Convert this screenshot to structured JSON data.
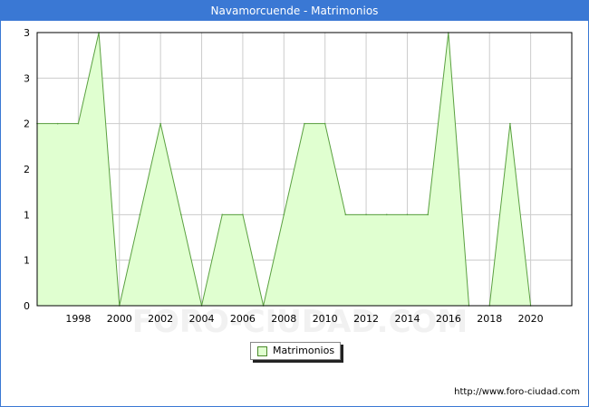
{
  "title": "Navamorcuende - Matrimonios",
  "footer_url": "http://www.foro-ciudad.com",
  "watermark": "FORO-CIUDAD.COM",
  "colors": {
    "title_bg": "#3a78d4",
    "area_fill": "#e0ffd0",
    "area_stroke": "#5aa040",
    "grid": "#cccccc"
  },
  "chart_data": {
    "type": "area",
    "title": "Navamorcuende - Matrimonios",
    "xlabel": "",
    "ylabel": "",
    "x": [
      1996,
      1997,
      1998,
      1999,
      2000,
      2001,
      2002,
      2003,
      2004,
      2005,
      2006,
      2007,
      2008,
      2009,
      2010,
      2011,
      2012,
      2013,
      2014,
      2015,
      2016,
      2017,
      2018,
      2019,
      2020
    ],
    "series": [
      {
        "name": "Matrimonios",
        "values": [
          2,
          2,
          2,
          3,
          0,
          1,
          2,
          1,
          0,
          1,
          1,
          0,
          1,
          2,
          2,
          1,
          1,
          1,
          1,
          1,
          3,
          0,
          0,
          2,
          0
        ]
      }
    ],
    "x_ticks": [
      1998,
      2000,
      2002,
      2004,
      2006,
      2008,
      2010,
      2012,
      2014,
      2016,
      2018,
      2020
    ],
    "y_tick_labels": [
      "0",
      "1",
      "1",
      "2",
      "2",
      "3",
      "3"
    ],
    "xlim": [
      1996,
      2022
    ],
    "ylim": [
      0,
      3
    ],
    "grid": true,
    "legend_position": "bottom-center"
  }
}
